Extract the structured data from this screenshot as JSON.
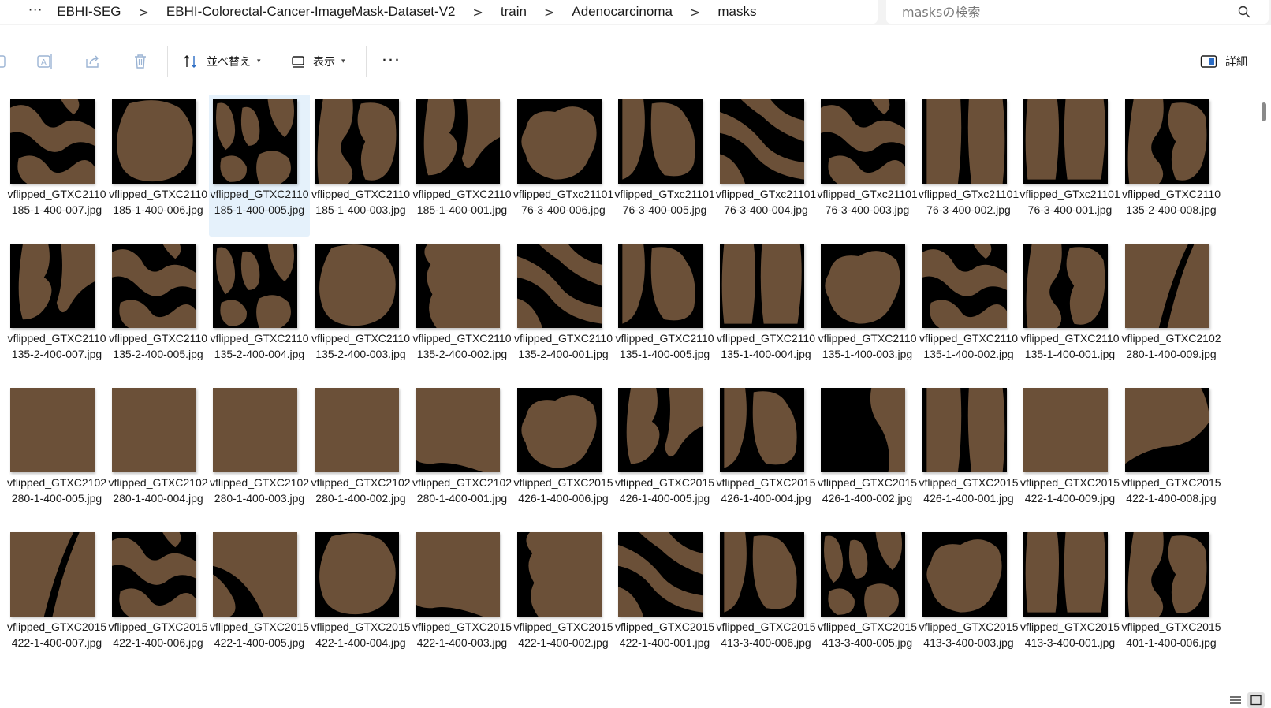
{
  "breadcrumb": {
    "more": "···",
    "items": [
      "EBHI-SEG",
      "EBHI-Colorectal-Cancer-ImageMask-Dataset-V2",
      "train",
      "Adenocarcinoma",
      "masks"
    ],
    "separator": ">"
  },
  "search": {
    "placeholder": "masksの検索"
  },
  "toolbar": {
    "sort_label": "並べ替え",
    "view_label": "表示",
    "more": "···",
    "details_label": "詳細"
  },
  "colors": {
    "mask_tissue": "#6b5038",
    "mask_background": "#000000",
    "selection": "#e5f1fb"
  },
  "files": [
    {
      "name": "vflipped_GTXC2110185-1-400-007.jpg",
      "shape": 0
    },
    {
      "name": "vflipped_GTXC2110185-1-400-006.jpg",
      "shape": 1
    },
    {
      "name": "vflipped_GTXC2110185-1-400-005.jpg",
      "shape": 2,
      "selected": true
    },
    {
      "name": "vflipped_GTXC2110185-1-400-003.jpg",
      "shape": 3
    },
    {
      "name": "vflipped_GTXC2110185-1-400-001.jpg",
      "shape": 4
    },
    {
      "name": "vflipped_GTxc2110176-3-400-006.jpg",
      "shape": 5
    },
    {
      "name": "vflipped_GTxc2110176-3-400-005.jpg",
      "shape": 6
    },
    {
      "name": "vflipped_GTxc2110176-3-400-004.jpg",
      "shape": 7
    },
    {
      "name": "vflipped_GTxc2110176-3-400-003.jpg",
      "shape": 0
    },
    {
      "name": "vflipped_GTxc2110176-3-400-002.jpg",
      "shape": 8
    },
    {
      "name": "vflipped_GTxc2110176-3-400-001.jpg",
      "shape": 9
    },
    {
      "name": "vflipped_GTXC2110135-2-400-008.jpg",
      "shape": 3
    },
    {
      "name": "vflipped_GTXC2110135-2-400-007.jpg",
      "shape": 4
    },
    {
      "name": "vflipped_GTXC2110135-2-400-005.jpg",
      "shape": 0
    },
    {
      "name": "vflipped_GTXC2110135-2-400-004.jpg",
      "shape": 2
    },
    {
      "name": "vflipped_GTXC2110135-2-400-003.jpg",
      "shape": 1
    },
    {
      "name": "vflipped_GTXC2110135-2-400-002.jpg",
      "shape": 10
    },
    {
      "name": "vflipped_GTXC2110135-2-400-001.jpg",
      "shape": 7
    },
    {
      "name": "vflipped_GTXC2110135-1-400-005.jpg",
      "shape": 6
    },
    {
      "name": "vflipped_GTXC2110135-1-400-004.jpg",
      "shape": 9
    },
    {
      "name": "vflipped_GTXC2110135-1-400-003.jpg",
      "shape": 5
    },
    {
      "name": "vflipped_GTXC2110135-1-400-002.jpg",
      "shape": 0
    },
    {
      "name": "vflipped_GTXC2110135-1-400-001.jpg",
      "shape": 3
    },
    {
      "name": "vflipped_GTXC2102280-1-400-009.jpg",
      "shape": 11
    },
    {
      "name": "vflipped_GTXC2102280-1-400-005.jpg",
      "shape": 12
    },
    {
      "name": "vflipped_GTXC2102280-1-400-004.jpg",
      "shape": 12
    },
    {
      "name": "vflipped_GTXC2102280-1-400-003.jpg",
      "shape": 12
    },
    {
      "name": "vflipped_GTXC2102280-1-400-002.jpg",
      "shape": 12
    },
    {
      "name": "vflipped_GTXC2102280-1-400-001.jpg",
      "shape": 13
    },
    {
      "name": "vflipped_GTXC2015426-1-400-006.jpg",
      "shape": 5
    },
    {
      "name": "vflipped_GTXC2015426-1-400-005.jpg",
      "shape": 4
    },
    {
      "name": "vflipped_GTXC2015426-1-400-004.jpg",
      "shape": 6
    },
    {
      "name": "vflipped_GTXC2015426-1-400-002.jpg",
      "shape": 14
    },
    {
      "name": "vflipped_GTXC2015426-1-400-001.jpg",
      "shape": 8
    },
    {
      "name": "vflipped_GTXC2015422-1-400-009.jpg",
      "shape": 12
    },
    {
      "name": "vflipped_GTXC2015422-1-400-008.jpg",
      "shape": 15
    },
    {
      "name": "vflipped_GTXC2015422-1-400-007.jpg",
      "shape": 11
    },
    {
      "name": "vflipped_GTXC2015422-1-400-006.jpg",
      "shape": 0
    },
    {
      "name": "vflipped_GTXC2015422-1-400-005.jpg",
      "shape": 16
    },
    {
      "name": "vflipped_GTXC2015422-1-400-004.jpg",
      "shape": 1
    },
    {
      "name": "vflipped_GTXC2015422-1-400-003.jpg",
      "shape": 13
    },
    {
      "name": "vflipped_GTXC2015422-1-400-002.jpg",
      "shape": 10
    },
    {
      "name": "vflipped_GTXC2015422-1-400-001.jpg",
      "shape": 7
    },
    {
      "name": "vflipped_GTXC2015413-3-400-006.jpg",
      "shape": 6
    },
    {
      "name": "vflipped_GTXC2015413-3-400-005.jpg",
      "shape": 2
    },
    {
      "name": "vflipped_GTXC2015413-3-400-003.jpg",
      "shape": 5
    },
    {
      "name": "vflipped_GTXC2015413-3-400-001.jpg",
      "shape": 9
    },
    {
      "name": "vflipped_GTXC2015401-1-400-006.jpg",
      "shape": 3
    }
  ]
}
